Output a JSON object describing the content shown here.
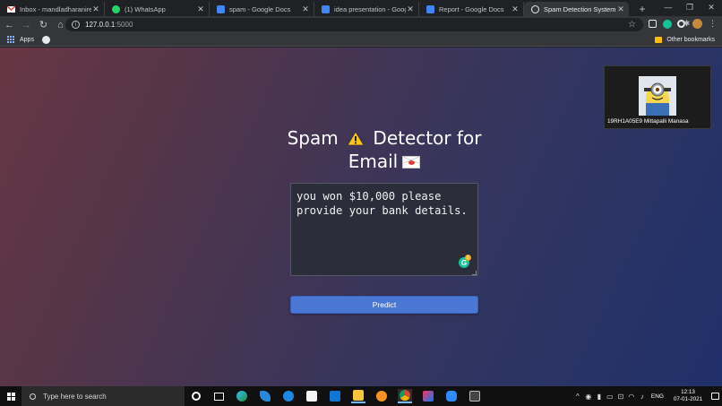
{
  "browser": {
    "tabs": [
      {
        "title": "Inbox - mandladharanireddy",
        "favicon": "gmail-icon",
        "active": false
      },
      {
        "title": "(1) WhatsApp",
        "favicon": "whatsapp-icon",
        "active": false
      },
      {
        "title": "spam - Google Docs",
        "favicon": "docs-icon",
        "active": false
      },
      {
        "title": "idea presentation - Google D",
        "favicon": "docs-icon",
        "active": false
      },
      {
        "title": "Report - Google Docs",
        "favicon": "docs-icon",
        "active": false
      },
      {
        "title": "Spam Detection System",
        "favicon": "globe-icon",
        "active": true
      }
    ],
    "address": {
      "host": "127.0.0.1",
      "port": ":5000"
    },
    "bookmarks": {
      "apps_label": "Apps",
      "other_label": "Other bookmarks"
    }
  },
  "page": {
    "title_line1": "Spam",
    "title_line1_after": "Detector for",
    "title_line2": "Email",
    "message_text": "you won $10,000 please provide your bank details.",
    "predict_label": "Predict",
    "grammarly_count": "8"
  },
  "webcam": {
    "name": "19RH1A05E9 Mittapalli Manasa"
  },
  "taskbar": {
    "search_placeholder": "Type here to search",
    "language": "ENG",
    "time": "12:13",
    "date": "07-01-2021"
  },
  "colors": {
    "accent_button": "#4a77d4",
    "page_gradient_start": "#673644",
    "page_gradient_end": "#20306a"
  }
}
